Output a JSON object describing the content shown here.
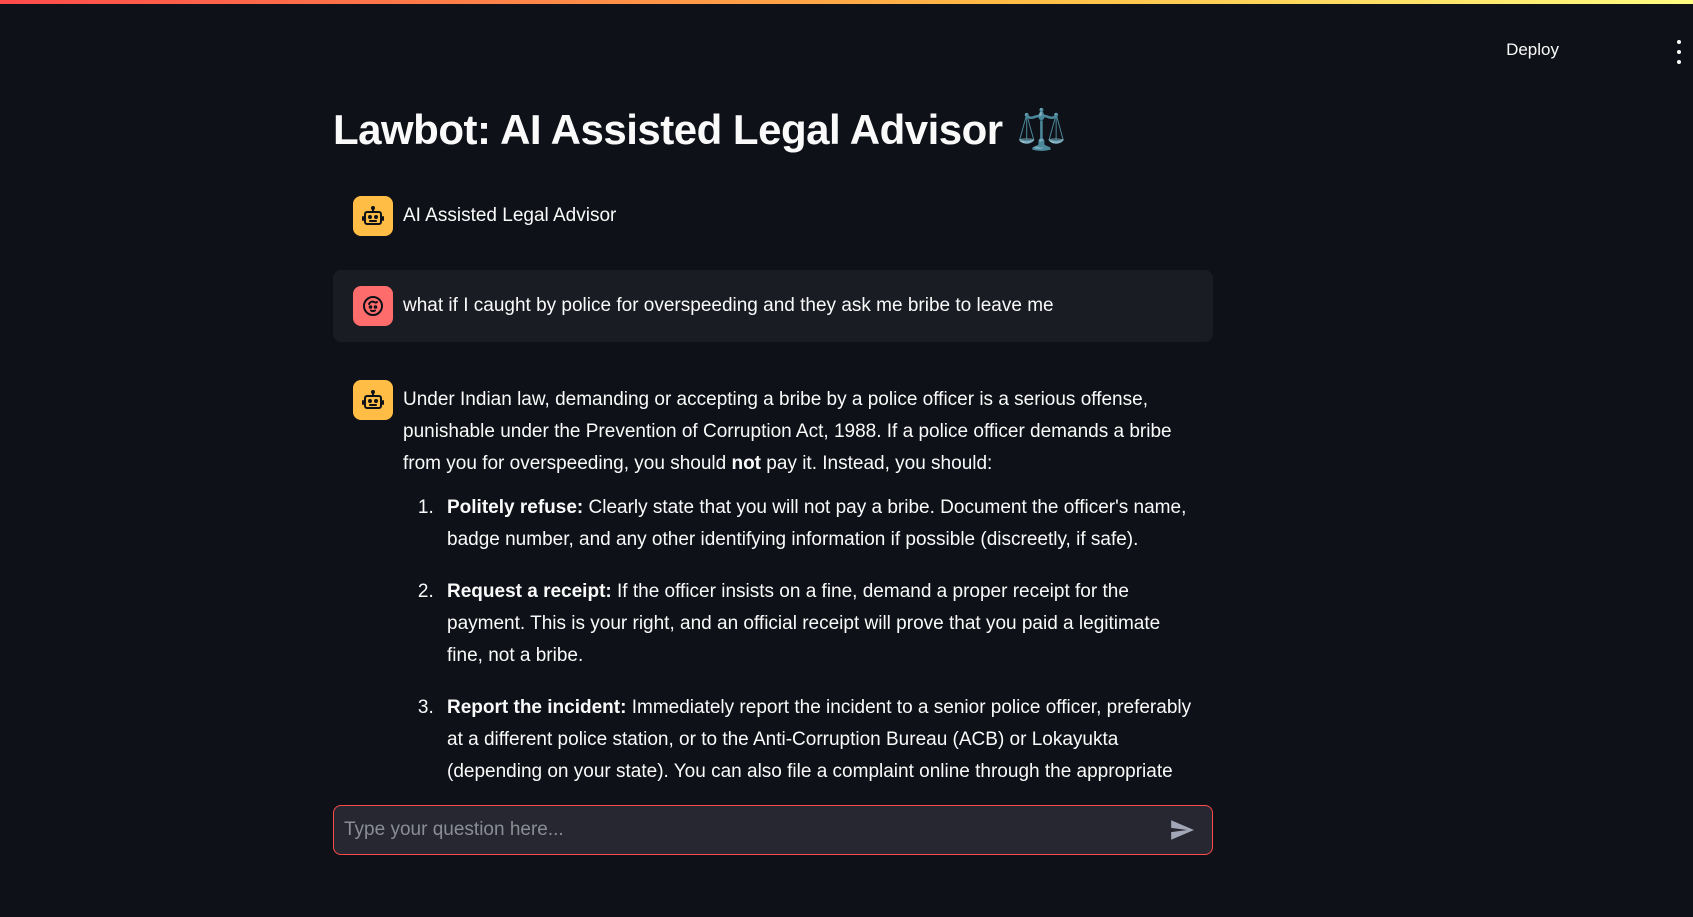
{
  "header": {
    "deploy_label": "Deploy",
    "menu_icon": "vertical-dots-icon"
  },
  "title": {
    "text": "Lawbot: AI Assisted Legal Advisor",
    "emoji": "⚖️"
  },
  "messages": [
    {
      "role": "assistant",
      "avatar_icon": "robot-icon",
      "text": "AI Assisted Legal Advisor"
    },
    {
      "role": "user",
      "avatar_icon": "user-face-icon",
      "text": "what if I caught by police for overspeeding and they ask me bribe to leave me"
    },
    {
      "role": "assistant",
      "avatar_icon": "robot-icon",
      "intro_before_bold": "Under Indian law, demanding or accepting a bribe by a police officer is a serious offense, punishable under the Prevention of Corruption Act, 1988. If a police officer demands a bribe from you for overspeeding, you should ",
      "intro_bold": "not",
      "intro_after_bold": " pay it. Instead, you should:",
      "steps": [
        {
          "heading": "Politely refuse:",
          "text": " Clearly state that you will not pay a bribe. Document the officer's name, badge number, and any other identifying information if possible (discreetly, if safe)."
        },
        {
          "heading": "Request a receipt:",
          "text": " If the officer insists on a fine, demand a proper receipt for the payment. This is your right, and an official receipt will prove that you paid a legitimate fine, not a bribe."
        },
        {
          "heading": "Report the incident:",
          "text": " Immediately report the incident to a senior police officer, preferably at a different police station, or to the Anti-Corruption Bureau (ACB) or Lokayukta (depending on your state). You can also file a complaint online through the appropriate channels. Provide all details of the incident, including the time, location, officer's identity, and any witnesses."
        }
      ]
    }
  ],
  "chat_input": {
    "placeholder": "Type your question here...",
    "value": "",
    "send_icon": "send-arrow-icon"
  },
  "colors": {
    "background": "#0e1117",
    "accent": "#ff4b4b",
    "bot_avatar": "#ffbd45",
    "user_avatar": "#ff6c6c",
    "user_bubble": "#1a1c24"
  }
}
